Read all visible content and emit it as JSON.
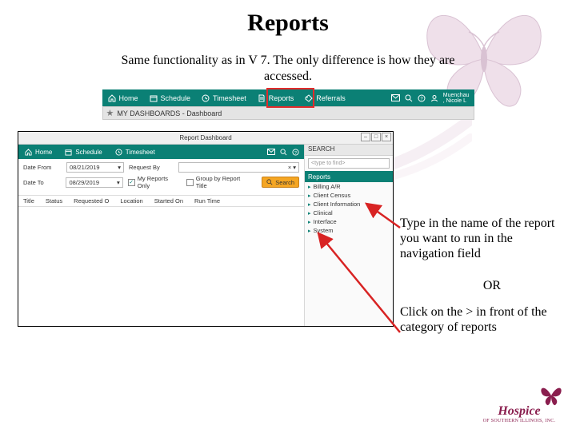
{
  "title": "Reports",
  "subtitle": "Same functionality as in V 7. The only difference is how they are accessed.",
  "topbar": {
    "home": "Home",
    "schedule": "Schedule",
    "timesheet": "Timesheet",
    "reports": "Reports",
    "referrals": "Referrals",
    "user_line1": "Muenchau",
    "user_line2": ", Nicole L"
  },
  "dashbar": {
    "label": "MY DASHBOARDS - Dashboard"
  },
  "screenshot2": {
    "win_title": "Report Dashboard",
    "nav": {
      "home": "Home",
      "schedule": "Schedule",
      "timesheet": "Timesheet"
    },
    "filters": {
      "date_from_label": "Date From",
      "date_from_value": "08/21/2019",
      "date_to_label": "Date To",
      "date_to_value": "08/29/2019",
      "request_by_label": "Request By",
      "request_by_value": "",
      "my_reports_only": "My Reports Only",
      "my_reports_checked": "✓",
      "group_by": "Group by Report Title",
      "search_btn": "Search"
    },
    "columns": [
      "Title",
      "Status",
      "Requested O",
      "Location",
      "Started On",
      "Run Time"
    ],
    "right": {
      "search_header": "SEARCH",
      "search_placeholder": "<type to find>",
      "reports_section": "Reports",
      "categories": [
        "Billing A/R",
        "Client Census",
        "Client Information",
        "Clinical",
        "Interface",
        "System"
      ]
    }
  },
  "annotations": {
    "a1": "Type in the name of the report you want to run in the navigation field",
    "or": "OR",
    "a2": "Click on the > in front of the category of reports"
  },
  "logo": {
    "brand": "Hospice",
    "sub": "OF SOUTHERN ILLINOIS, INC."
  }
}
